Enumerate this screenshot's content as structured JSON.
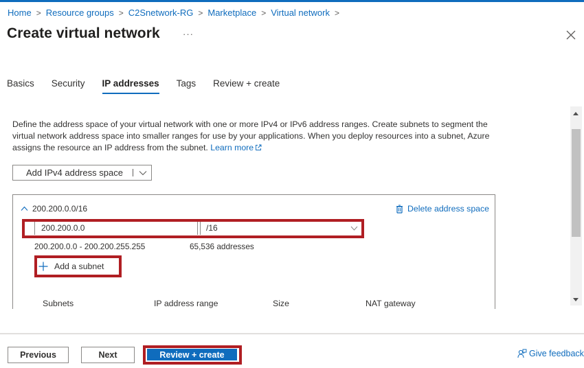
{
  "breadcrumb": [
    "Home",
    "Resource groups",
    "C2Snetwork-RG",
    "Marketplace",
    "Virtual network"
  ],
  "page": {
    "title": "Create virtual network",
    "more_label": "···",
    "close_icon": "close-icon"
  },
  "tabs": [
    {
      "label": "Basics",
      "active": false
    },
    {
      "label": "Security",
      "active": false
    },
    {
      "label": "IP addresses",
      "active": true
    },
    {
      "label": "Tags",
      "active": false
    },
    {
      "label": "Review + create",
      "active": false
    }
  ],
  "description": {
    "text": "Define the address space of your virtual network with one or more IPv4 or IPv6 address ranges. Create subnets to segment the virtual network address space into smaller ranges for use by your applications. When you deploy resources into a subnet, Azure assigns the resource an IP address from the subnet.",
    "link_label": "Learn more",
    "link_icon": "external-link-icon"
  },
  "add_address_space": {
    "label": "Add IPv4 address space",
    "icon": "chevron-down-icon"
  },
  "address_space": {
    "header": "200.200.0.0/16",
    "delete_label": "Delete address space",
    "delete_icon": "trash-icon",
    "start_address_value": "200.200.0.0",
    "prefix_selected": "/16",
    "range_text": "200.200.0.0 - 200.200.255.255",
    "count_text": "65,536 addresses",
    "add_subnet_label": "Add a subnet",
    "subnet_columns": [
      "Subnets",
      "IP address range",
      "Size",
      "NAT gateway"
    ]
  },
  "footer": {
    "previous_label": "Previous",
    "next_label": "Next",
    "review_create_label": "Review + create",
    "feedback_label": "Give feedback",
    "feedback_icon": "feedback-icon"
  },
  "colors": {
    "accent": "#0f6cbd",
    "highlight": "#b01e23"
  }
}
